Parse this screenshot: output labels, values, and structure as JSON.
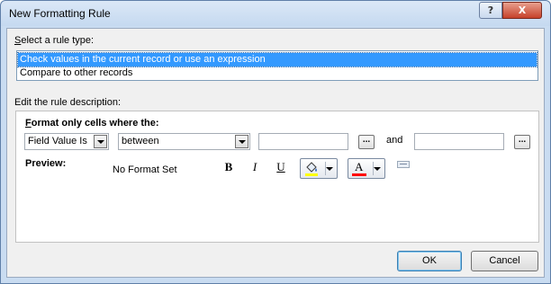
{
  "window": {
    "title": "New Formatting Rule",
    "help_glyph": "?",
    "close_glyph": "X"
  },
  "rule_type": {
    "label": "Select a rule type:",
    "label_key": "S",
    "label_rest": "elect a rule type:",
    "items": [
      {
        "label": "Check values in the current record or use an expression",
        "selected": true
      },
      {
        "label": "Compare to other records",
        "selected": false
      }
    ]
  },
  "description": {
    "label": "Edit the rule description:",
    "format_label_key": "F",
    "format_label_rest": "ormat only cells where the:",
    "field_combo_value": "Field Value Is",
    "operator_combo_value": "between",
    "value1": "",
    "value2": "",
    "and_label": "and",
    "ellipsis_label": "...",
    "preview_label": "Preview:",
    "preview_text": "No Format Set",
    "bold_label": "B",
    "italic_label": "I",
    "underline_label": "U",
    "fill_color": "#ffff00",
    "font_color": "#ff0000",
    "font_color_glyph": "A"
  },
  "buttons": {
    "ok": "OK",
    "cancel": "Cancel"
  }
}
